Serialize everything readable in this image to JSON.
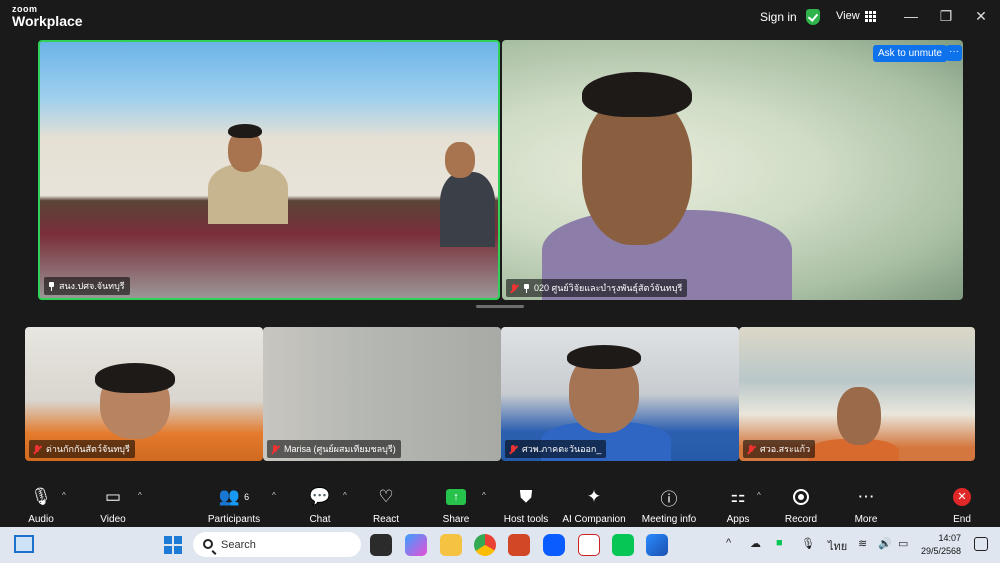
{
  "app": {
    "brand_top": "zoom",
    "brand_bottom": "Workplace"
  },
  "titlebar": {
    "sign_in": "Sign in",
    "view": "View",
    "minimize": "—",
    "restore": "❐",
    "close": "✕"
  },
  "overlay": {
    "ask_to_unmute": "Ask to unmute",
    "more": "···"
  },
  "participants": [
    {
      "name": "สนง.ปศจ.จันทบุรี",
      "muted": false,
      "pinned": true
    },
    {
      "name": "020 ศูนย์วิจัยและบำรุงพันธุ์สัตว์จันทบุรี",
      "muted": true,
      "pinned": true
    },
    {
      "name": "ด่านกักกันสัตว์จันทบุรี",
      "muted": true
    },
    {
      "name": "Marisa (ศูนย์ผสมเทียมชลบุรี)",
      "muted": true
    },
    {
      "name": "ศวพ.ภาคตะวันออก_",
      "muted": true
    },
    {
      "name": "ศวอ.สระแก้ว",
      "muted": true
    }
  ],
  "toolbar": {
    "audio": "Audio",
    "video": "Video",
    "participants": "Participants",
    "participants_count": "6",
    "chat": "Chat",
    "react": "React",
    "share": "Share",
    "host_tools": "Host tools",
    "ai_companion": "AI Companion",
    "meeting_info": "Meeting info",
    "apps": "Apps",
    "record": "Record",
    "more": "More",
    "end": "End"
  },
  "taskbar": {
    "search_placeholder": "Search",
    "lang": "ไทย",
    "time": "14:07",
    "date": "29/5/2568"
  },
  "colors": {
    "active_speaker": "#30d158",
    "accent": "#0e72ed",
    "end": "#e02828",
    "share": "#27c24c"
  }
}
